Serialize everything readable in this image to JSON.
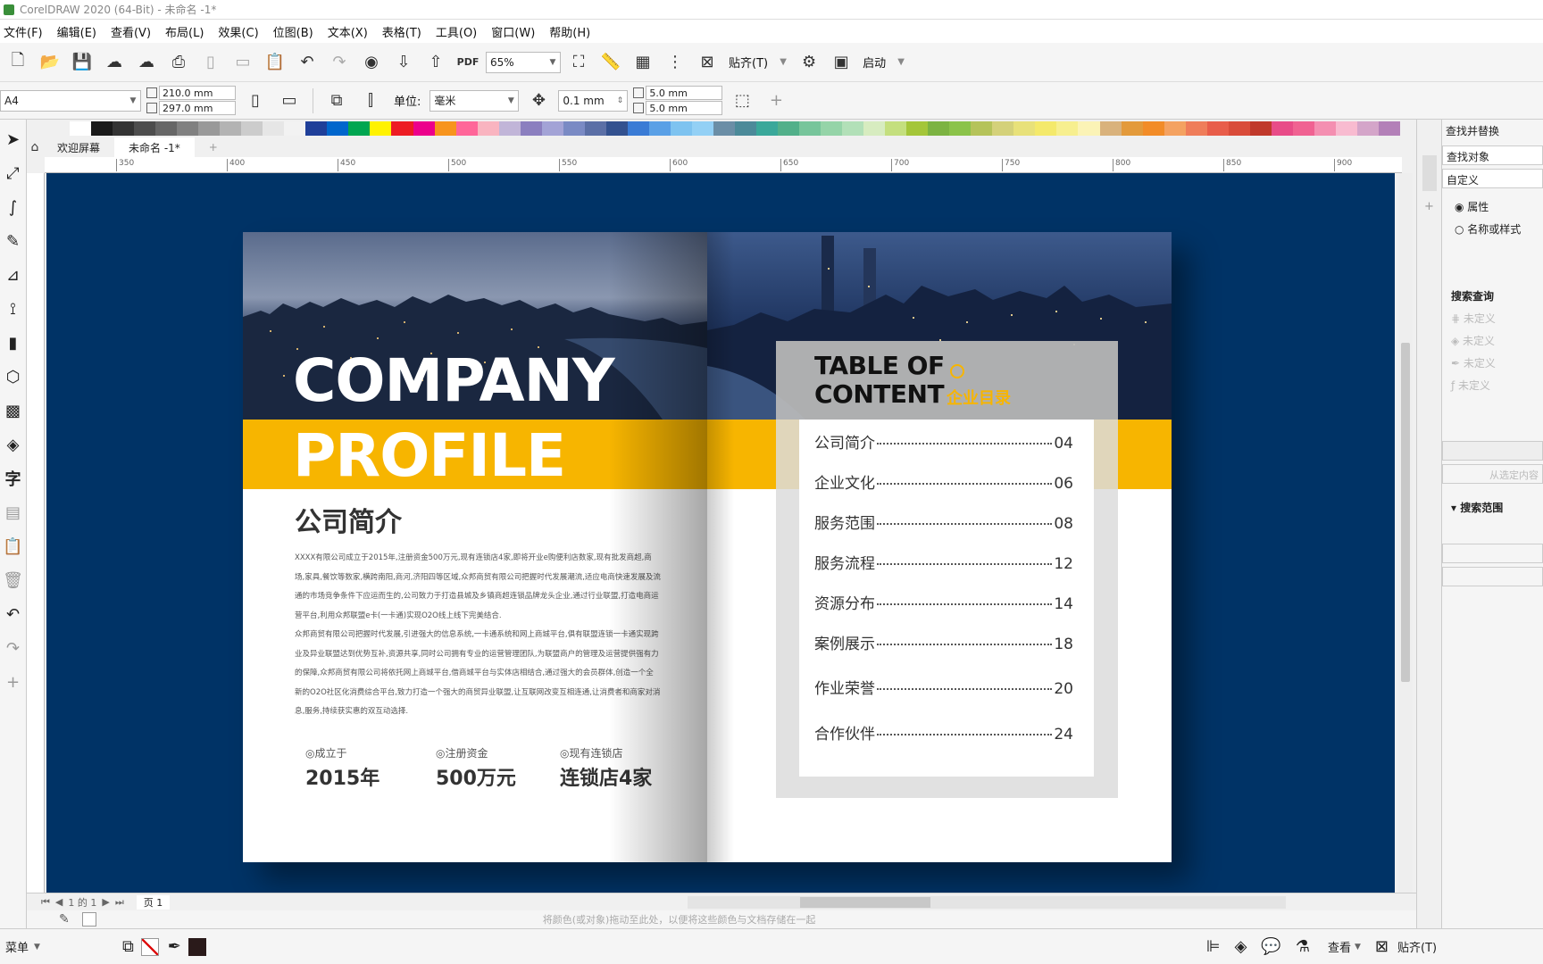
{
  "window": {
    "title": "CorelDRAW 2020 (64-Bit) - 未命名 -1*"
  },
  "menu": [
    "文件(F)",
    "编辑(E)",
    "查看(V)",
    "布局(L)",
    "效果(C)",
    "位图(B)",
    "文本(X)",
    "表格(T)",
    "工具(O)",
    "窗口(W)",
    "帮助(H)"
  ],
  "standard_bar": {
    "zoom": "65%",
    "snap_label": "贴齐(T)",
    "launch_label": "启动"
  },
  "property_bar": {
    "page_size": "A4",
    "width": "210.0 mm",
    "height": "297.0 mm",
    "units_label": "单位:",
    "units_value": "毫米",
    "nudge": "0.1 mm",
    "dup_x": "5.0 mm",
    "dup_y": "5.0 mm"
  },
  "doc_tabs": {
    "welcome": "欢迎屏幕",
    "current": "未命名 -1*"
  },
  "ruler_ticks": [
    "350",
    "400",
    "450",
    "500",
    "550",
    "600",
    "650",
    "700",
    "750",
    "800",
    "850",
    "900"
  ],
  "palette": [
    "#ffffff",
    "#1a1a1a",
    "#333333",
    "#4d4d4d",
    "#666666",
    "#808080",
    "#999999",
    "#b3b3b3",
    "#cccccc",
    "#e6e6e6",
    "#f2f2f2",
    "#1f3f99",
    "#0066cc",
    "#00a651",
    "#fff200",
    "#ed1c24",
    "#ec008c",
    "#f7941d",
    "#ff6699",
    "#f9b4c0",
    "#c1b5d8",
    "#8b7fbf",
    "#a3a3d6",
    "#7a8ac4",
    "#5b6fa6",
    "#33518f",
    "#3a7bd5",
    "#5aa0e6",
    "#7ec3f0",
    "#93d0f5",
    "#6b8ea6",
    "#4c8a99",
    "#3aa89a",
    "#52b08a",
    "#77c59b",
    "#95d4a8",
    "#b2e0b8",
    "#d7ecc0",
    "#c4df7e",
    "#a4c639",
    "#7cb342",
    "#8bc34a",
    "#b5c35a",
    "#d4d17a",
    "#e8e17a",
    "#f4e96b",
    "#f7ef8f",
    "#fbf3b6",
    "#d9b27c",
    "#e39a3b",
    "#f28c28",
    "#f4a261",
    "#ef7d5a",
    "#e85d4a",
    "#d94c3a",
    "#c0392b",
    "#e84c88",
    "#f06292",
    "#f48fb1",
    "#f8bbd0",
    "#d4a5c9",
    "#b380b8"
  ],
  "document": {
    "cover_line1": "COMPANY",
    "cover_line2": "PROFILE",
    "section_title": "公司简介",
    "paragraph1": "XXXX有限公司成立于2015年,注册资金500万元,现有连锁店4家,即将开业e购便利店数家,现有批发商超,商场,家具,餐饮等数家,横跨南阳,商河,济阳四等区域,众邦商贸有限公司把握时代发展潮流,适应电商快速发展及流通的市场竞争条件下应运而生的,公司致力于打造县城及乡镇商超连锁品牌龙头企业,通过行业联盟,打造电商运营平台,利用众邦联盟e卡(一卡通)实现O2O线上线下完美结合.",
    "paragraph2": "众邦商贸有限公司把握时代发展,引进强大的信息系统,一卡通系统和网上商城平台,俱有联盟连锁一卡通实现跨业及异业联盟达到优势互补,资源共享,同时公司拥有专业的运营管理团队,为联盟商户的管理及运营提供强有力的保障,众邦商贸有限公司将依托网上商城平台,借商城平台与实体店相结合,通过强大的会员群体,创造一个全新的O2O社区化消费综合平台,致力打造一个强大的商贸异业联盟,让互联网改变互相连通,让消费者和商家对消息,服务,持续获实惠的双互动选择.",
    "stats": [
      {
        "label": "成立于",
        "value": "2015年"
      },
      {
        "label": "注册资金",
        "value": "500万元"
      },
      {
        "label": "现有连锁店",
        "value": "连锁店4家"
      }
    ],
    "toc_title_line1": "TABLE OF",
    "toc_title_line2": "CONTENT",
    "toc_cn": "企业目录",
    "toc": [
      {
        "title": "公司简介",
        "page": "04"
      },
      {
        "title": "企业文化",
        "page": "06"
      },
      {
        "title": "服务范围",
        "page": "08"
      },
      {
        "title": "服务流程",
        "page": "12"
      },
      {
        "title": "资源分布",
        "page": "14"
      },
      {
        "title": "案例展示",
        "page": "18"
      },
      {
        "title": "作业荣誉",
        "page": "20"
      },
      {
        "title": "合作伙伴",
        "page": "24"
      }
    ]
  },
  "page_nav": {
    "position": "1 的 1",
    "page_tab": "页 1"
  },
  "drag_hint": "将颜色(或对象)拖动至此处，以便将这些颜色与文档存储在一起",
  "docker": {
    "title": "查找并替换",
    "find_label": "查找对象",
    "custom": "自定义",
    "option1": "属性",
    "option2": "名称或样式",
    "query_title": "搜索查询",
    "undefined": "未定义",
    "from_selection": "从选定内容",
    "scope_title": "搜索范围"
  },
  "statusbar": {
    "menu": "菜单",
    "view": "查看",
    "snap": "贴齐(T)"
  },
  "colors": {
    "canvas_bg": "#003366",
    "accent_yellow": "#f7b500"
  }
}
